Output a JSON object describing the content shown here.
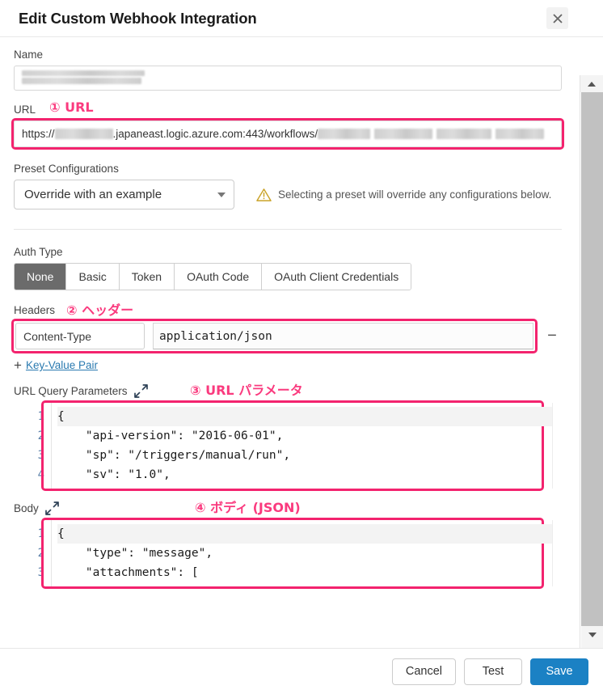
{
  "header": {
    "title": "Edit Custom Webhook Integration",
    "close_icon": "close-icon"
  },
  "form": {
    "name": {
      "label": "Name",
      "value": ""
    },
    "url": {
      "label": "URL",
      "value_prefix": "https://",
      "value_mid": ".japaneast.logic.azure.com:443/workflows/",
      "value": "https://        .japaneast.logic.azure.com:443/workflows/"
    },
    "preset": {
      "label": "Preset Configurations",
      "selected": "Override with an example",
      "warning": "Selecting a preset will override any configurations below.",
      "warning_icon": "warning-triangle-icon"
    },
    "auth": {
      "label": "Auth Type",
      "tabs": [
        {
          "label": "None",
          "active": true
        },
        {
          "label": "Basic",
          "active": false
        },
        {
          "label": "Token",
          "active": false
        },
        {
          "label": "OAuth Code",
          "active": false
        },
        {
          "label": "OAuth Client Credentials",
          "active": false
        }
      ]
    },
    "headers": {
      "label": "Headers",
      "key": "Content-Type",
      "value": "application/json",
      "remove_label": "−",
      "add_link": "Key-Value Pair",
      "add_glyph": "+"
    },
    "query_params": {
      "label": "URL Query Parameters",
      "expand_icon": "expand-icon",
      "line_numbers": [
        "1",
        "2",
        "3",
        "4"
      ],
      "lines": [
        "{",
        "    \"api-version\": \"2016-06-01\",",
        "    \"sp\": \"/triggers/manual/run\",",
        "    \"sv\": \"1.0\","
      ]
    },
    "body": {
      "label": "Body",
      "expand_icon": "expand-icon",
      "line_numbers": [
        "1",
        "2",
        "3"
      ],
      "lines": [
        "{",
        "    \"type\": \"message\",",
        "    \"attachments\": ["
      ]
    }
  },
  "annotations": {
    "a1": "① URL",
    "a2": "② ヘッダー",
    "a3": "③ URL パラメータ",
    "a4": "④ ボディ (JSON)",
    "color": "#fa3a7e"
  },
  "footer": {
    "cancel": "Cancel",
    "test": "Test",
    "save": "Save",
    "primary_color": "#1b81c4"
  }
}
